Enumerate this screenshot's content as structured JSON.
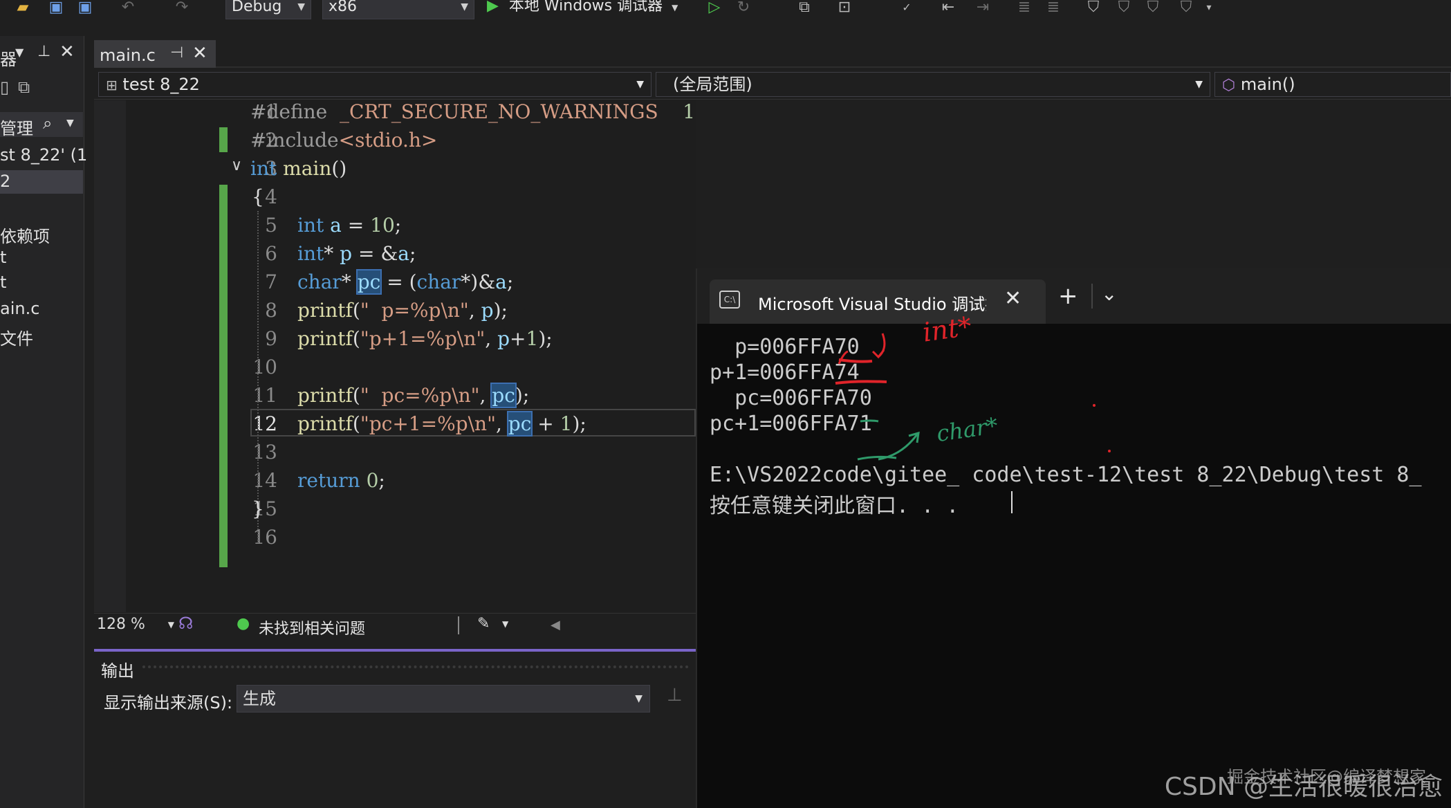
{
  "toolbar": {
    "config": "Debug",
    "platform": "x86",
    "run_label": "本地 Windows 调试器"
  },
  "left_panel": {
    "items": [
      "器",
      "管理",
      "st 8_22' (1",
      "2",
      "依赖项",
      "t",
      "t",
      "ain.c",
      "文件"
    ]
  },
  "editor": {
    "tab_label": "main.c",
    "project_nav": "test 8_22",
    "scope_nav": "(全局范围)",
    "member_nav": "main()",
    "lines": [
      {
        "n": "1",
        "text": "#define  _CRT_SECURE_NO_WARNINGS    1"
      },
      {
        "n": "2",
        "text": "#include<stdio.h>"
      },
      {
        "n": "3",
        "text": "int main()"
      },
      {
        "n": "4",
        "text": "{"
      },
      {
        "n": "5",
        "text": "int a = 10;"
      },
      {
        "n": "6",
        "text": "int* p = &a;"
      },
      {
        "n": "7",
        "text": "char* pc = (char*)&a;"
      },
      {
        "n": "8",
        "text": "printf(\"  p=%p\\n\", p);"
      },
      {
        "n": "9",
        "text": "printf(\"p+1=%p\\n\", p+1);"
      },
      {
        "n": "10",
        "text": ""
      },
      {
        "n": "11",
        "text": "printf(\"  pc=%p\\n\", pc);"
      },
      {
        "n": "12",
        "text": "printf(\"pc+1=%p\\n\", pc + 1);"
      },
      {
        "n": "13",
        "text": ""
      },
      {
        "n": "14",
        "text": "return 0;"
      },
      {
        "n": "15",
        "text": "}"
      },
      {
        "n": "16",
        "text": ""
      }
    ],
    "zoom": "128 %",
    "status": "未找到相关问题"
  },
  "output": {
    "title": "输出",
    "source_label": "显示输出来源(S):",
    "source_value": "生成"
  },
  "console": {
    "title": "Microsoft Visual Studio 调试控",
    "lines": [
      "  p=006FFA70",
      "p+1=006FFA74",
      "  pc=006FFA70",
      "pc+1=006FFA71",
      "",
      "E:\\VS2022code\\gitee_ code\\test-12\\test 8_22\\Debug\\test 8_",
      "按任意键关闭此窗口. . ."
    ],
    "annotations": [
      "int*",
      "char*"
    ]
  },
  "watermark": "CSDN @生活很暖很治愈",
  "watermark2": "掘金技术社区@编译梦想家",
  "colors": {
    "keyword": "#569cd6",
    "string": "#d69d85",
    "highlight": "#264f78",
    "change_bar": "#57a64a",
    "annotation_red": "#e0242a",
    "annotation_green": "#2f9a6a"
  }
}
